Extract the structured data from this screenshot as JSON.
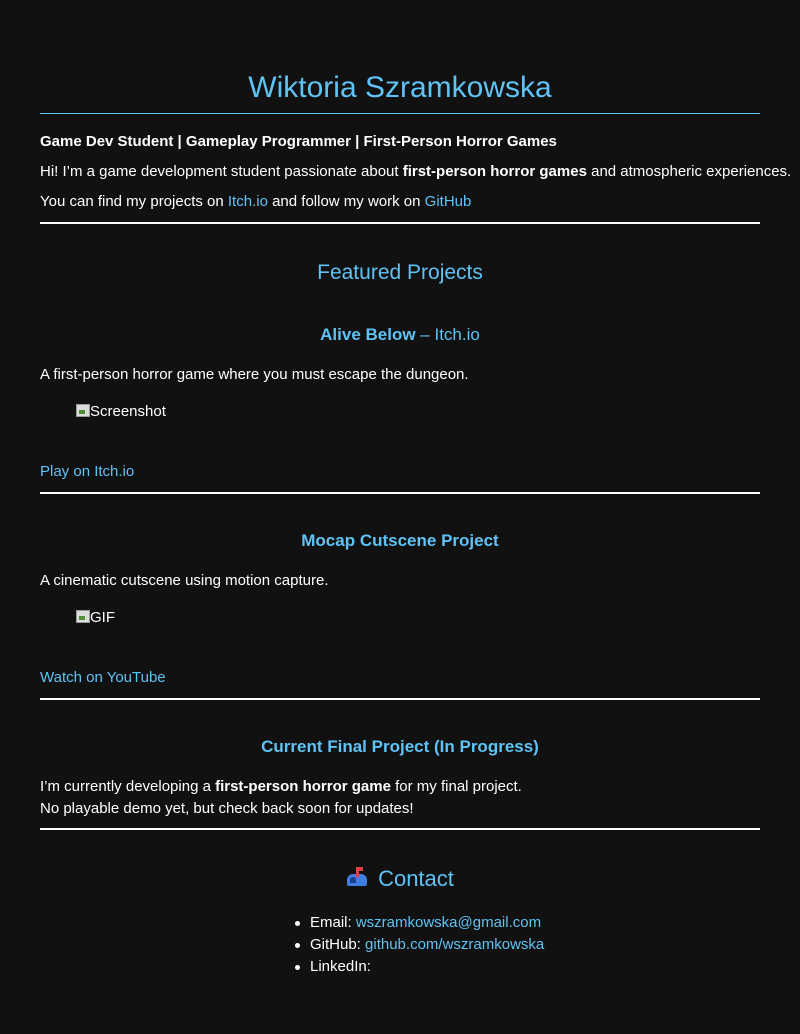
{
  "header": {
    "name": "Wiktoria Szramkowska",
    "tagline": "Game Dev Student | Gameplay Programmer | First-Person Horror Games"
  },
  "intro": {
    "line1_pre": "Hi! I’m a game development student passionate about ",
    "line1_bold": "first-person horror games",
    "line1_post": " and atmospheric experiences.",
    "line2_pre": "You can find my projects on ",
    "line2_link1": "Itch.io",
    "line2_mid": " and follow my work on ",
    "line2_link2": "GitHub"
  },
  "projects": {
    "heading": "Featured Projects",
    "alive": {
      "title": "Alive Below",
      "dash": " – ",
      "title_link": "Itch.io",
      "description": "A first-person horror game where you must escape the dungeon.",
      "image_alt": "Screenshot",
      "link": "Play on Itch.io"
    },
    "mocap": {
      "title": "Mocap Cutscene Project",
      "description": "A cinematic cutscene using motion capture.",
      "image_alt": "GIF",
      "link": "Watch on YouTube"
    },
    "final": {
      "title": "Current Final Project (In Progress)",
      "line1_pre": "I’m currently developing a ",
      "line1_bold": "first-person horror game",
      "line1_post": " for my final project.",
      "line2": "No playable demo yet, but check back soon for updates!"
    }
  },
  "contact": {
    "heading": "Contact",
    "icon": "mailbox-icon",
    "email_label": "Email: ",
    "email_value": "wszramkowska@gmail.com",
    "github_label": "GitHub: ",
    "github_value": "github.com/wszramkowska",
    "linkedin_label": "LinkedIn:"
  },
  "colors": {
    "background": "#111111",
    "accent": "#5fc3f5",
    "text": "#ffffff"
  }
}
